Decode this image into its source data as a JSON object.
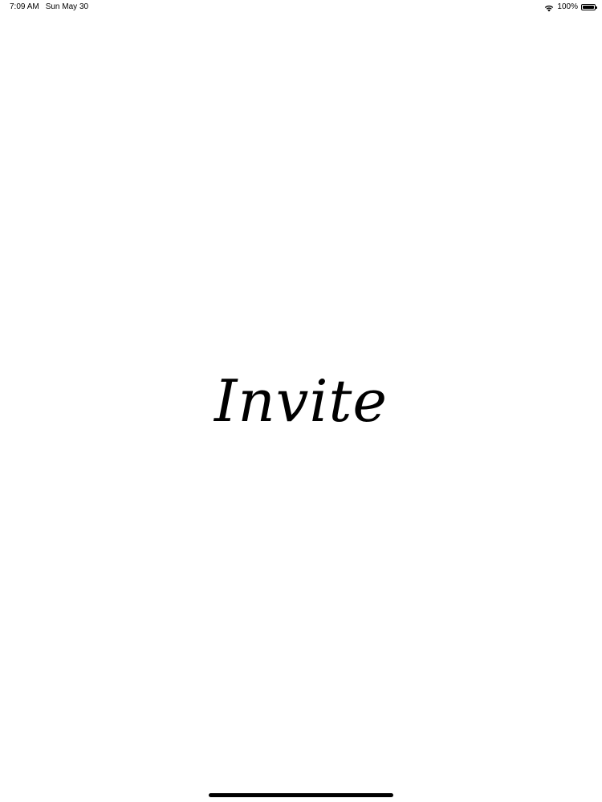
{
  "status_bar": {
    "time": "7:09 AM",
    "date": "Sun May 30",
    "battery_text": "100%",
    "battery_level_percent": 100,
    "wifi_icon": "wifi-icon",
    "battery_icon": "battery-icon"
  },
  "splash": {
    "title": "Invite"
  },
  "colors": {
    "background": "#ffffff",
    "text": "#000000"
  }
}
